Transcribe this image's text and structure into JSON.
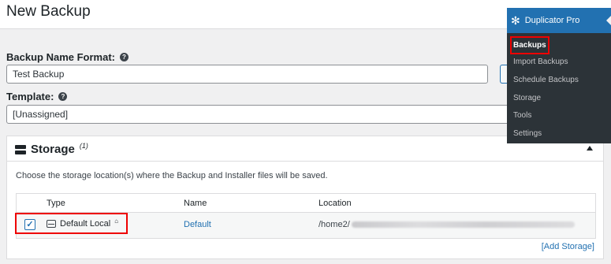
{
  "page": {
    "title": "New Backup"
  },
  "form": {
    "name_format_label": "Backup Name Format:",
    "name_format_value": "Test Backup",
    "template_label": "Template:",
    "template_value": "[Unassigned]",
    "help_glyph": "?"
  },
  "storage": {
    "title": "Storage",
    "title_sup": "(1)",
    "description": "Choose the storage location(s) where the Backup and Installer files will be saved.",
    "columns": [
      "Type",
      "Name",
      "Location"
    ],
    "rows": [
      {
        "checked": "✓",
        "type": "Default Local",
        "name": "Default",
        "location_prefix": "/home2/"
      }
    ],
    "add_link": "[Add Storage]"
  },
  "admin_menu": {
    "title": "Duplicator Pro",
    "items": [
      {
        "label": "Backups",
        "active": true
      },
      {
        "label": "Import Backups"
      },
      {
        "label": "Schedule Backups"
      },
      {
        "label": "Storage"
      },
      {
        "label": "Tools"
      },
      {
        "label": "Settings"
      }
    ]
  },
  "colors": {
    "accent": "#2271b1",
    "highlight": "#e00000",
    "menu_bg": "#2c3338"
  }
}
